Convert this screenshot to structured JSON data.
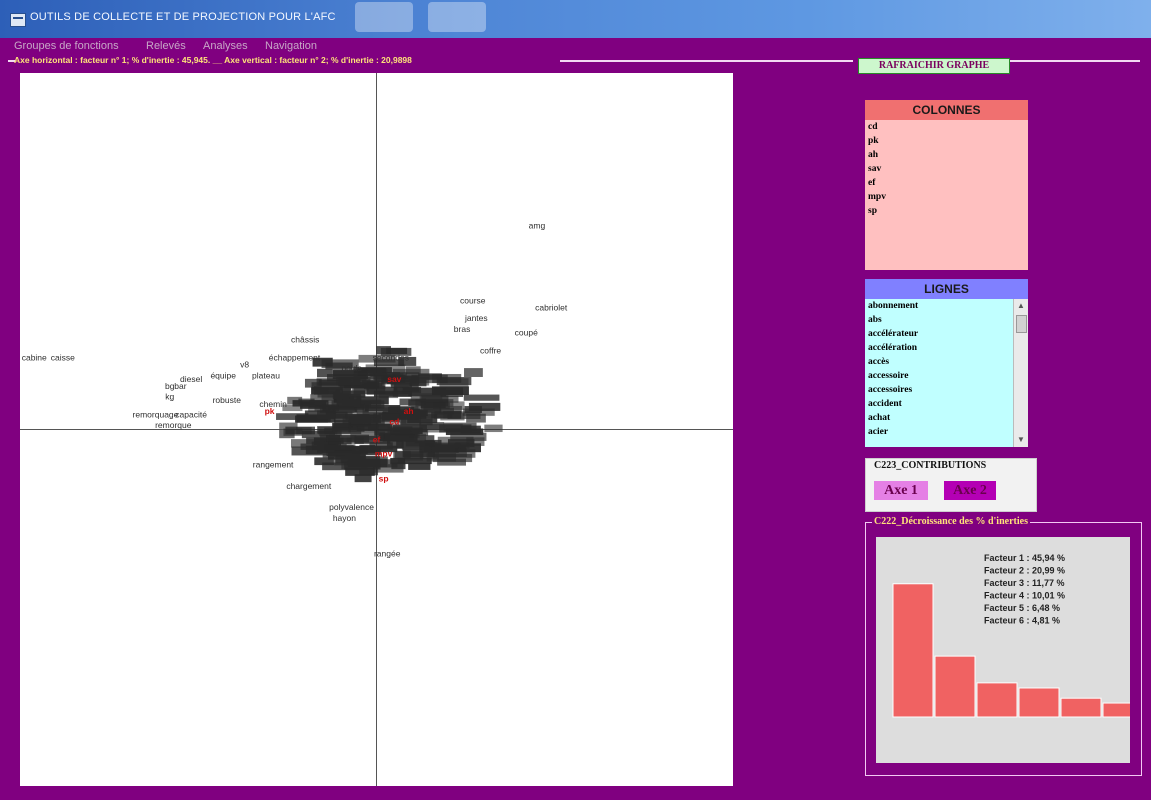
{
  "window": {
    "title": "OUTILS DE COLLECTE ET DE PROJECTION POUR L'AFC"
  },
  "menu": [
    "Groupes de fonctions",
    "Relevés",
    "Analyses",
    "Navigation"
  ],
  "axis_info": "Axe horizontal : facteur n° 1; % d'inertie : 45,945. __ Axe vertical : facteur n° 2; % d'inertie : 20,9898",
  "refresh_button": "RAFRAICHIR GRAPHE",
  "colonnes": {
    "title": "COLONNES",
    "items": [
      "cd",
      "pk",
      "ah",
      "sav",
      "ef",
      "mpv",
      "sp"
    ]
  },
  "lignes": {
    "title": "LIGNES",
    "items": [
      "abonnement",
      "abs",
      "accélérateur",
      "accélération",
      "accès",
      "accessoire",
      "accessoires",
      "accident",
      "achat",
      "acier"
    ]
  },
  "contributions": {
    "title": "C223_CONTRIBUTIONS",
    "axe1": "Axe 1",
    "axe2": "Axe 2"
  },
  "colors": {
    "window_bg": "#800080",
    "colonnes_header": "#f07070",
    "colonnes_body": "#ffc0c0",
    "lignes_header": "#8080ff",
    "lignes_body": "#c0ffff",
    "bar_fill": "#f06262",
    "axe1_bg": "#e580e5",
    "axe2_bg": "#b400b4",
    "point_labels": "#303030",
    "column_points": "#d01010"
  },
  "chart_data": [
    {
      "type": "scatter",
      "title": "",
      "xlabel": "",
      "ylabel": "",
      "grid": false,
      "axes_crossing": [
        0,
        0
      ],
      "xlim": [
        -1.0,
        1.0
      ],
      "ylim": [
        -1.0,
        1.0
      ],
      "points": [
        {
          "label": "amg",
          "x": 0.45,
          "y": 0.57,
          "color": "text"
        },
        {
          "label": "course",
          "x": 0.27,
          "y": 0.36,
          "color": "text"
        },
        {
          "label": "cabriolet",
          "x": 0.49,
          "y": 0.34,
          "color": "text"
        },
        {
          "label": "jantes",
          "x": 0.28,
          "y": 0.31,
          "color": "text"
        },
        {
          "label": "bras",
          "x": 0.24,
          "y": 0.28,
          "color": "text"
        },
        {
          "label": "coupé",
          "x": 0.42,
          "y": 0.27,
          "color": "text"
        },
        {
          "label": "coffre",
          "x": 0.32,
          "y": 0.22,
          "color": "text"
        },
        {
          "label": "châssis",
          "x": -0.2,
          "y": 0.25,
          "color": "text"
        },
        {
          "label": "échappement",
          "x": -0.23,
          "y": 0.2,
          "color": "text"
        },
        {
          "label": "cabine",
          "x": -0.96,
          "y": 0.2,
          "color": "text"
        },
        {
          "label": "caisse",
          "x": -0.88,
          "y": 0.2,
          "color": "text"
        },
        {
          "label": "v8",
          "x": -0.37,
          "y": 0.18,
          "color": "text"
        },
        {
          "label": "plateau",
          "x": -0.31,
          "y": 0.15,
          "color": "text"
        },
        {
          "label": "équipe",
          "x": -0.43,
          "y": 0.15,
          "color": "text"
        },
        {
          "label": "diesel",
          "x": -0.52,
          "y": 0.14,
          "color": "text"
        },
        {
          "label": "bar",
          "x": -0.55,
          "y": 0.12,
          "color": "text"
        },
        {
          "label": "bg",
          "x": -0.58,
          "y": 0.12,
          "color": "text"
        },
        {
          "label": "kg",
          "x": -0.58,
          "y": 0.09,
          "color": "text"
        },
        {
          "label": "robuste",
          "x": -0.42,
          "y": 0.08,
          "color": "text"
        },
        {
          "label": "remorquage",
          "x": -0.62,
          "y": 0.04,
          "color": "text"
        },
        {
          "label": "capacité",
          "x": -0.52,
          "y": 0.04,
          "color": "text"
        },
        {
          "label": "remorque",
          "x": -0.57,
          "y": 0.01,
          "color": "text"
        },
        {
          "label": "chemin",
          "x": -0.29,
          "y": 0.07,
          "color": "text"
        },
        {
          "label": "secondes",
          "x": 0.04,
          "y": 0.2,
          "color": "text"
        },
        {
          "label": "poids",
          "x": -0.07,
          "y": 0.17,
          "color": "text"
        },
        {
          "label": "rangement",
          "x": -0.29,
          "y": -0.1,
          "color": "text"
        },
        {
          "label": "chargement",
          "x": -0.19,
          "y": -0.16,
          "color": "text"
        },
        {
          "label": "polyvalence",
          "x": -0.07,
          "y": -0.22,
          "color": "text"
        },
        {
          "label": "hayon",
          "x": -0.09,
          "y": -0.25,
          "color": "text"
        },
        {
          "label": "rangée",
          "x": 0.03,
          "y": -0.35,
          "color": "text"
        },
        {
          "label": "pk",
          "x": -0.3,
          "y": 0.05,
          "color": "column"
        },
        {
          "label": "ah",
          "x": 0.09,
          "y": 0.05,
          "color": "column"
        },
        {
          "label": "cd",
          "x": 0.05,
          "y": 0.02,
          "color": "column"
        },
        {
          "label": "sav",
          "x": 0.05,
          "y": 0.14,
          "color": "column"
        },
        {
          "label": "ef",
          "x": 0.0,
          "y": -0.03,
          "color": "column"
        },
        {
          "label": "mpv",
          "x": 0.02,
          "y": -0.07,
          "color": "column"
        },
        {
          "label": "sp",
          "x": 0.02,
          "y": -0.14,
          "color": "column"
        }
      ],
      "cluster": {
        "center_x": 0.03,
        "center_y": 0.04,
        "spread_x": 0.33,
        "spread_y": 0.2,
        "note": "dense overlapping mass of unreadable row labels"
      }
    },
    {
      "type": "bar",
      "title": "C222_Décroissance des % d'inerties",
      "categories": [
        "Facteur 1",
        "Facteur 2",
        "Facteur 3",
        "Facteur 4",
        "Facteur 5",
        "Facteur 6"
      ],
      "values": [
        45.94,
        20.99,
        11.77,
        10.01,
        6.48,
        4.81
      ],
      "labels": [
        "Facteur 1 : 45,94 %",
        "Facteur 2 : 20,99 %",
        "Facteur 3 : 11,77 %",
        "Facteur 4 : 10,01 %",
        "Facteur 5 : 6,48 %",
        "Facteur 6 : 4,81 %"
      ],
      "ylim": [
        0,
        50
      ]
    }
  ]
}
